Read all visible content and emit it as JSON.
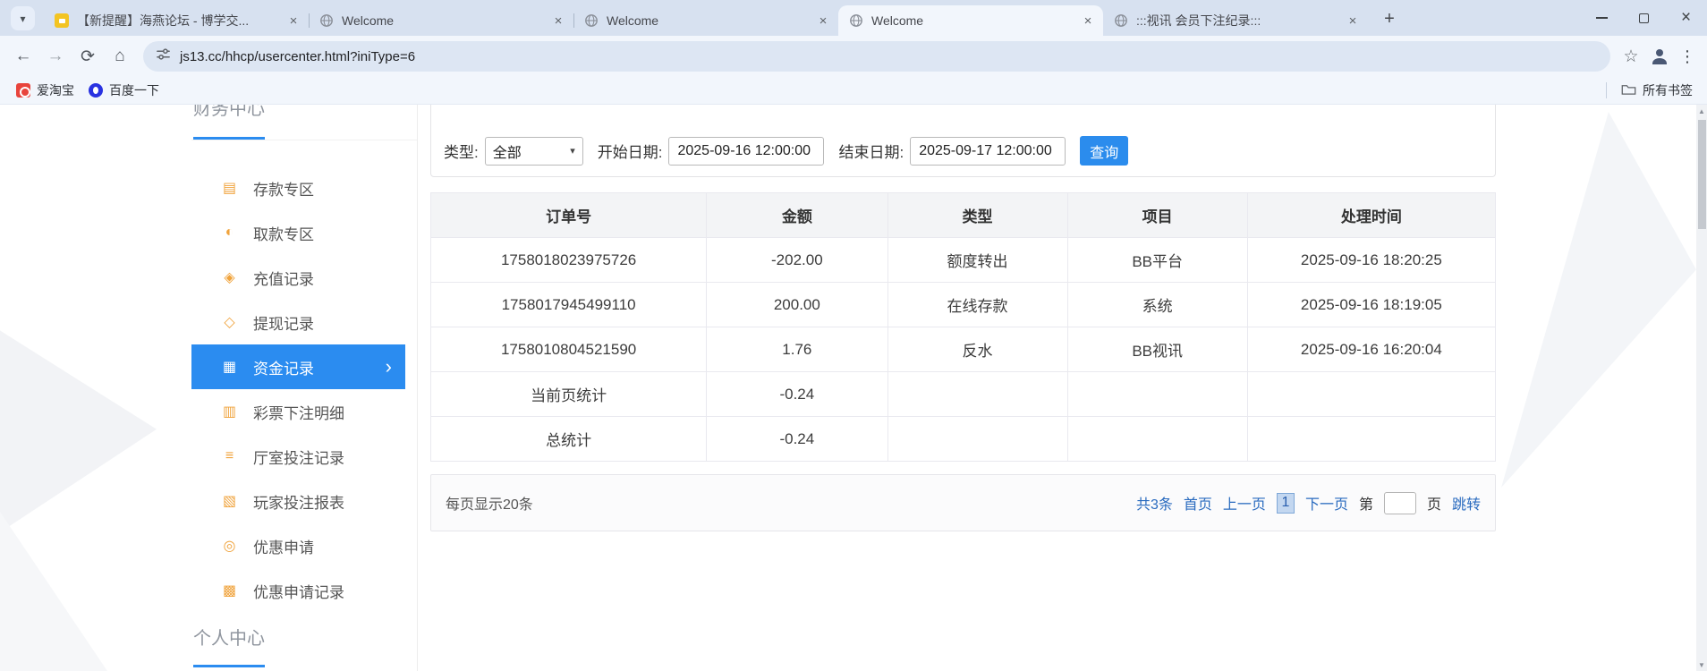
{
  "colors": {
    "accent_blue": "#2b8cf0",
    "link_blue": "#2a6bbf",
    "sidebar_icon_orange": "#f0a33c",
    "query_button_blue": "#2b8ced"
  },
  "icons": {
    "close": "×",
    "plus": "+",
    "back": "←",
    "forward": "→",
    "reload": "⟳",
    "home": "⌂",
    "star": "☆",
    "kebab": "⋮",
    "chevron_right": "›",
    "dropdown": "▾",
    "tab_search": "▾",
    "scroll_up": "▲",
    "scroll_down": "▼"
  },
  "browser": {
    "tabs": [
      {
        "title": "【新提醒】海燕论坛 - 博学交..."
      },
      {
        "title": "Welcome"
      },
      {
        "title": "Welcome"
      },
      {
        "title": "Welcome"
      },
      {
        "title": ":::视讯 会员下注纪录:::"
      }
    ],
    "url": "js13.cc/hhcp/usercenter.html?iniType=6",
    "bookmarks": {
      "taobao": "爱淘宝",
      "baidu": "百度一下",
      "all_bookmarks": "所有书签"
    }
  },
  "sidebar": {
    "section_top": "财务中心",
    "section_bottom": "个人中心",
    "items": [
      {
        "label": "存款专区",
        "icon": "▤"
      },
      {
        "label": "取款专区",
        "icon": "◐"
      },
      {
        "label": "充值记录",
        "icon": "◈"
      },
      {
        "label": "提现记录",
        "icon": "◇"
      },
      {
        "label": "资金记录",
        "icon": "▦"
      },
      {
        "label": "彩票下注明细",
        "icon": "▥"
      },
      {
        "label": "厅室投注记录",
        "icon": "≡"
      },
      {
        "label": "玩家投注报表",
        "icon": "▧"
      },
      {
        "label": "优惠申请",
        "icon": "◎"
      },
      {
        "label": "优惠申请记录",
        "icon": "▩"
      }
    ]
  },
  "filters": {
    "type_label": "类型:",
    "type_value": "全部",
    "start_label": "开始日期:",
    "start_value": "2025-09-16 12:00:00",
    "end_label": "结束日期:",
    "end_value": "2025-09-17 12:00:00",
    "query_button": "查询"
  },
  "table": {
    "headers": [
      "订单号",
      "金额",
      "类型",
      "项目",
      "处理时间"
    ],
    "rows": [
      [
        "1758018023975726",
        "-202.00",
        "额度转出",
        "BB平台",
        "2025-09-16 18:20:25"
      ],
      [
        "1758017945499110",
        "200.00",
        "在线存款",
        "系统",
        "2025-09-16 18:19:05"
      ],
      [
        "1758010804521590",
        "1.76",
        "反水",
        "BB视讯",
        "2025-09-16 16:20:04"
      ],
      [
        "当前页统计",
        "-0.24",
        "",
        "",
        ""
      ],
      [
        "总统计",
        "-0.24",
        "",
        "",
        ""
      ]
    ]
  },
  "pagination": {
    "per_page": "每页显示20条",
    "total": "共3条",
    "first": "首页",
    "prev": "上一页",
    "current": "1",
    "next": "下一页",
    "jump_prefix": "第",
    "jump_suffix": "页",
    "jump_button": "跳转"
  }
}
